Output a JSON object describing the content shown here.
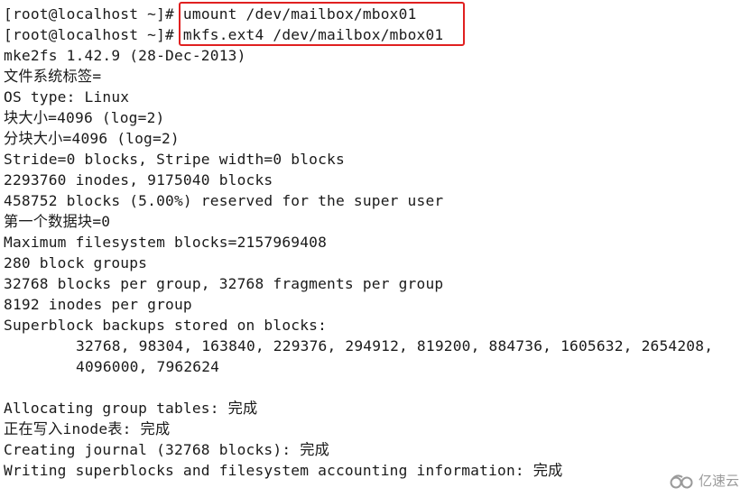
{
  "terminal": {
    "commands": [
      {
        "prompt": "[root@localhost ~]#",
        "command": "umount /dev/mailbox/mbox01"
      },
      {
        "prompt": "[root@localhost ~]#",
        "command": "mkfs.ext4 /dev/mailbox/mbox01"
      }
    ],
    "output": [
      "mke2fs 1.42.9 (28-Dec-2013)",
      "文件系统标签=",
      "OS type: Linux",
      "块大小=4096 (log=2)",
      "分块大小=4096 (log=2)",
      "Stride=0 blocks, Stripe width=0 blocks",
      "2293760 inodes, 9175040 blocks",
      "458752 blocks (5.00%) reserved for the super user",
      "第一个数据块=0",
      "Maximum filesystem blocks=2157969408",
      "280 block groups",
      "32768 blocks per group, 32768 fragments per group",
      "8192 inodes per group",
      "Superblock backups stored on blocks:"
    ],
    "backup_blocks": [
      "32768, 98304, 163840, 229376, 294912, 819200, 884736, 1605632, 2654208,",
      "4096000, 7962624"
    ],
    "output_after": [
      "",
      "Allocating group tables: 完成",
      "正在写入inode表: 完成",
      "Creating journal (32768 blocks): 完成",
      "Writing superblocks and filesystem accounting information: 完成"
    ]
  },
  "highlight": {
    "color": "#e02020"
  },
  "watermark": {
    "icon": "cloud-logo-icon",
    "text": "亿速云"
  }
}
